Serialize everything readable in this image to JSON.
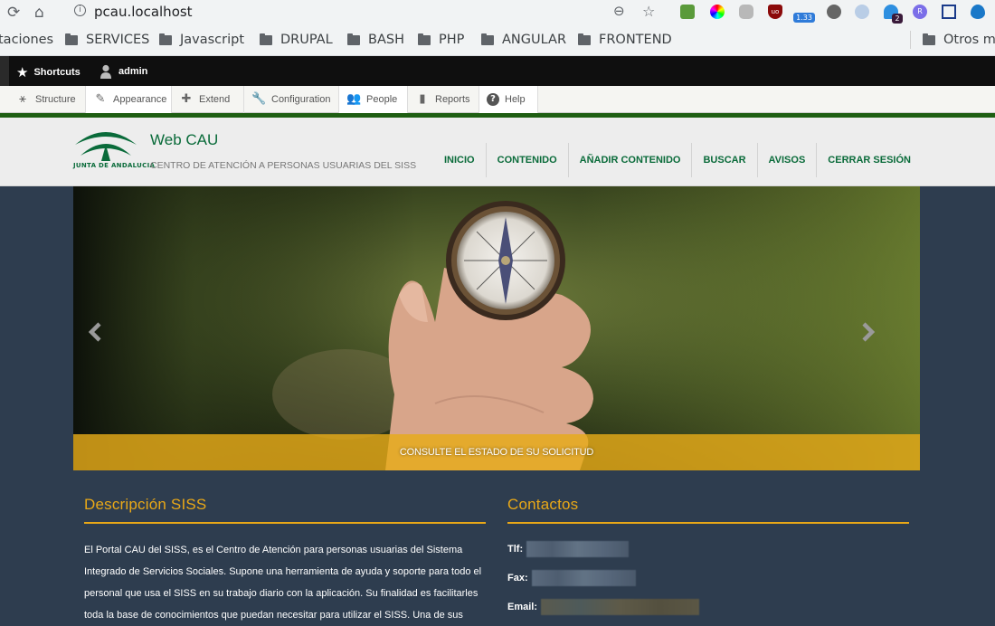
{
  "browser": {
    "url": "pcau.localhost",
    "extension_badges": {
      "timer": "1.33",
      "ghost_count": "2",
      "r_ext": "R"
    },
    "bookmarks": [
      {
        "label": "taciones",
        "folder": false
      },
      {
        "label": "SERVICES",
        "folder": true
      },
      {
        "label": "Javascript",
        "folder": true
      },
      {
        "label": "DRUPAL",
        "folder": true
      },
      {
        "label": "BASH",
        "folder": true
      },
      {
        "label": "PHP",
        "folder": true
      },
      {
        "label": "ANGULAR",
        "folder": true
      },
      {
        "label": "FRONTEND",
        "folder": true
      }
    ],
    "other_bookmarks": "Otros m"
  },
  "toolbar": {
    "shortcuts": "Shortcuts",
    "user": "admin",
    "tray": [
      "Structure",
      "Appearance",
      "Extend",
      "Configuration",
      "People",
      "Reports",
      "Help"
    ]
  },
  "site": {
    "logo_text": "JUNTA DE ANDALUCIA",
    "name": "Web CAU",
    "slogan": "CENTRO DE ATENCIÓN A PERSONAS USUARIAS DEL SISS",
    "nav": [
      "INICIO",
      "CONTENIDO",
      "AÑADIR CONTENIDO",
      "BUSCAR",
      "AVISOS",
      "CERRAR SESIÓN"
    ]
  },
  "slider": {
    "caption": "CONSULTE EL ESTADO DE SU SOLICITUD"
  },
  "footer": {
    "description": {
      "title": "Descripción SISS",
      "text": "El Portal CAU del SISS, es el Centro de Atención para personas usuarias del Sistema Integrado de Servicios Sociales. Supone una herramienta de ayuda y soporte para todo el personal que usa el SISS en su trabajo diario con la aplicación. Su finalidad es facilitarles toda la base de conocimientos que puedan necesitar para utilizar el SISS. Una de sus"
    },
    "contacts": {
      "title": "Contactos",
      "tlf_label": "Tlf:",
      "fax_label": "Fax:",
      "email_label": "Email:"
    }
  },
  "colors": {
    "brand_green": "#0a6b3a",
    "accent_yellow": "#e9a817",
    "footer_bg": "#2e3d4f",
    "toolbar_green": "#1e5e12"
  }
}
